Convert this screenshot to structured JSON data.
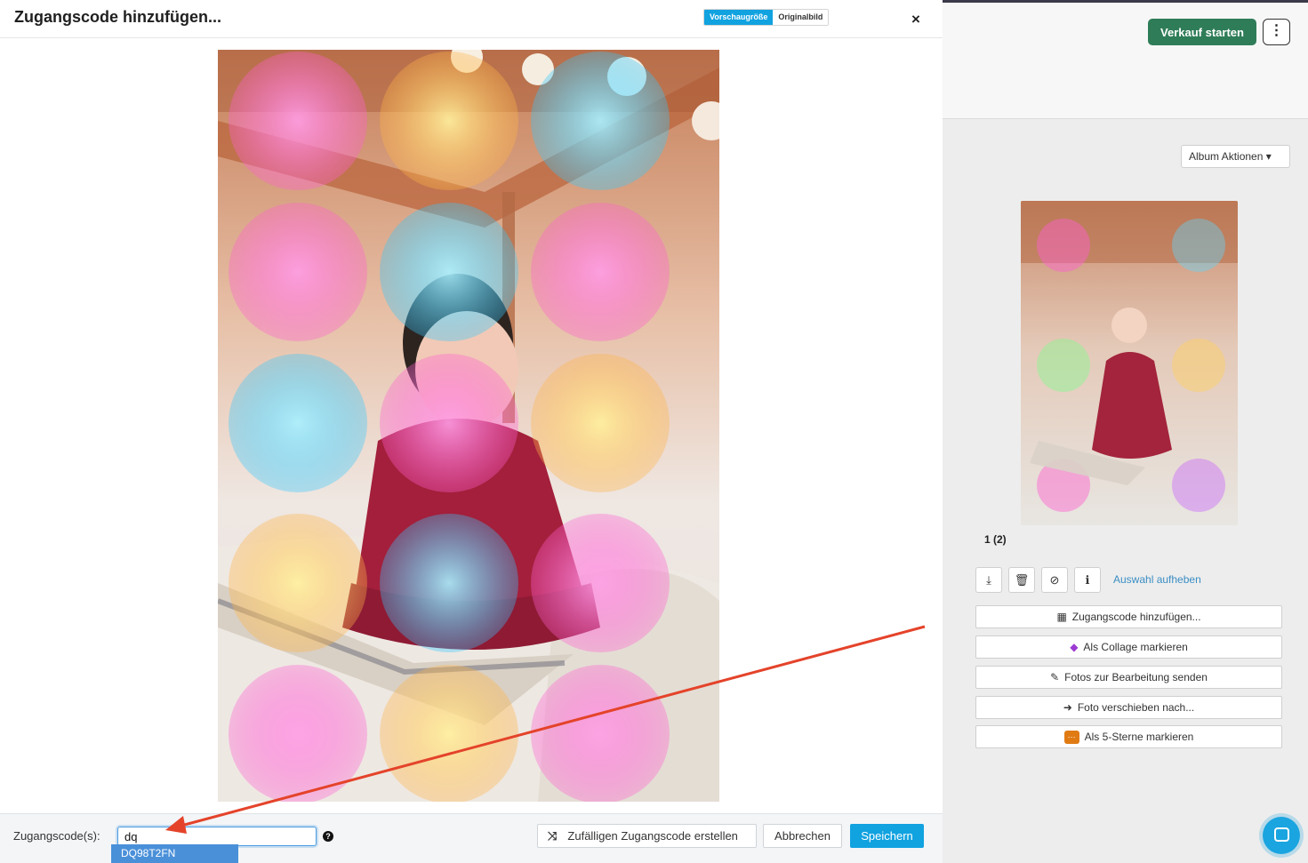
{
  "modal": {
    "title": "Zugangscode hinzufügen...",
    "view_toggle": {
      "preview": "Vorschaugröße",
      "original": "Originalbild"
    },
    "close_glyph": "×",
    "footer": {
      "code_label": "Zugangscode(s):",
      "code_value": "dq",
      "help_glyph": "?",
      "random_icon": "shuffle-icon",
      "random_glyph": "⤨",
      "random_label": "Zufälligen Zugangscode erstellen",
      "cancel_label": "Abbrechen",
      "save_label": "Speichern"
    },
    "suggestion": "DQ98T2FN"
  },
  "background_app": {
    "start_sale_label": "Verkauf starten",
    "more_glyph": "⋮",
    "album_actions_label": "Album Aktionen ▾",
    "thumbnail_count": "1 (2)",
    "toolbar": {
      "download_glyph": "⤓",
      "delete_glyph": "🗑",
      "hide_glyph": "⊘",
      "info_glyph": "ℹ"
    },
    "deselect_label": "Auswahl aufheben",
    "actions": [
      {
        "icon": "qr-icon",
        "glyph": "▦",
        "label": "Zugangscode hinzufügen..."
      },
      {
        "icon": "stack-icon",
        "glyph": "◆",
        "label": "Als Collage markieren"
      },
      {
        "icon": "edit-icon",
        "glyph": "✎",
        "label": "Fotos zur Bearbeitung senden"
      },
      {
        "icon": "move-icon",
        "glyph": "➜",
        "label": "Foto verschieben nach..."
      },
      {
        "icon": "star-rating-icon",
        "glyph": "···",
        "label": "Als 5-Sterne markieren"
      }
    ]
  },
  "colors": {
    "accent_blue": "#11a2e0",
    "start_green": "#2f7d58",
    "annotation_red": "#e4432a",
    "suggestion_blue": "#4a90d9"
  }
}
